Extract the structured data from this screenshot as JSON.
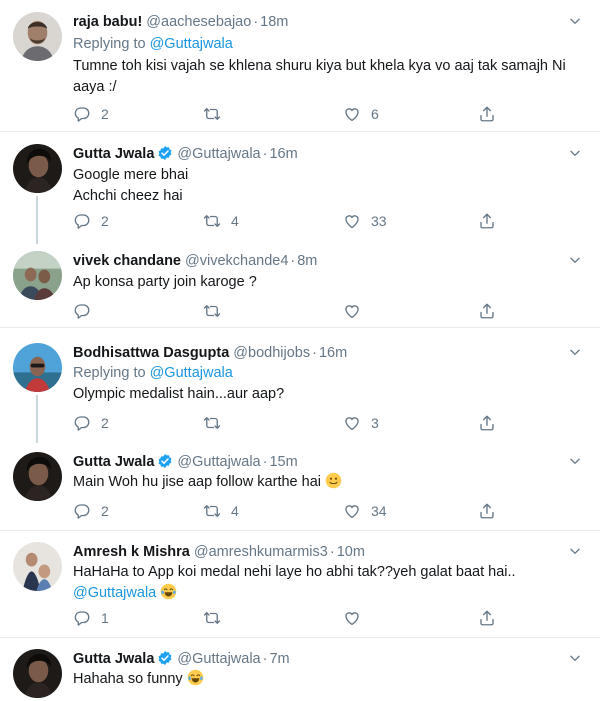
{
  "tweets": [
    {
      "name": "raja babu!",
      "verified": false,
      "handle": "@aachesebajao",
      "time": "18m",
      "replying_prefix": "Replying to",
      "replying_to": "@Guttajwala",
      "lines": [
        "Tumne toh kisi vajah se khlena shuru kiya but khela kya vo aaj tak samajh Ni",
        "aaya :/"
      ],
      "replies": "2",
      "retweets": "",
      "likes": "6"
    },
    {
      "name": "Gutta Jwala",
      "verified": true,
      "handle": "@Guttajwala",
      "time": "16m",
      "lines": [
        "Google mere bhai",
        "Achchi cheez hai"
      ],
      "replies": "2",
      "retweets": "4",
      "likes": "33"
    },
    {
      "name": "vivek chandane",
      "verified": false,
      "handle": "@vivekchande4",
      "time": "8m",
      "lines": [
        "Ap konsa party join karoge ?"
      ],
      "replies": "",
      "retweets": "",
      "likes": ""
    },
    {
      "name": "Bodhisattwa Dasgupta",
      "verified": false,
      "handle": "@bodhijobs",
      "time": "16m",
      "replying_prefix": "Replying to",
      "replying_to": "@Guttajwala",
      "lines": [
        "Olympic medalist hain...aur aap?"
      ],
      "replies": "2",
      "retweets": "",
      "likes": "3"
    },
    {
      "name": "Gutta Jwala",
      "verified": true,
      "handle": "@Guttajwala",
      "time": "15m",
      "lines": [
        "Main Woh hu jise aap follow karthe hai"
      ],
      "emoji": "slightly-smiling-face",
      "replies": "2",
      "retweets": "4",
      "likes": "34"
    },
    {
      "name": "Amresh k Mishra",
      "verified": false,
      "handle": "@amreshkumarmis3",
      "time": "10m",
      "lines": [
        "HaHaHa to App koi medal nehi laye ho abhi tak??yeh galat baat hai.."
      ],
      "mention_line": "@Guttajwala",
      "emoji": "face-with-tears-of-joy",
      "replies": "1",
      "retweets": "",
      "likes": ""
    },
    {
      "name": "Gutta Jwala",
      "verified": true,
      "handle": "@Guttajwala",
      "time": "7m",
      "lines": [
        "Hahaha so funny"
      ],
      "emoji": "face-with-tears-of-joy"
    }
  ],
  "separator": "·",
  "colors": {
    "link": "#1b95e0",
    "muted": "#657786",
    "line": "#ccd6dd",
    "divider": "#e6ecf0"
  },
  "icons": [
    "reply-icon",
    "retweet-icon",
    "like-icon",
    "share-icon",
    "chevron-down-icon",
    "verified-badge-icon"
  ]
}
